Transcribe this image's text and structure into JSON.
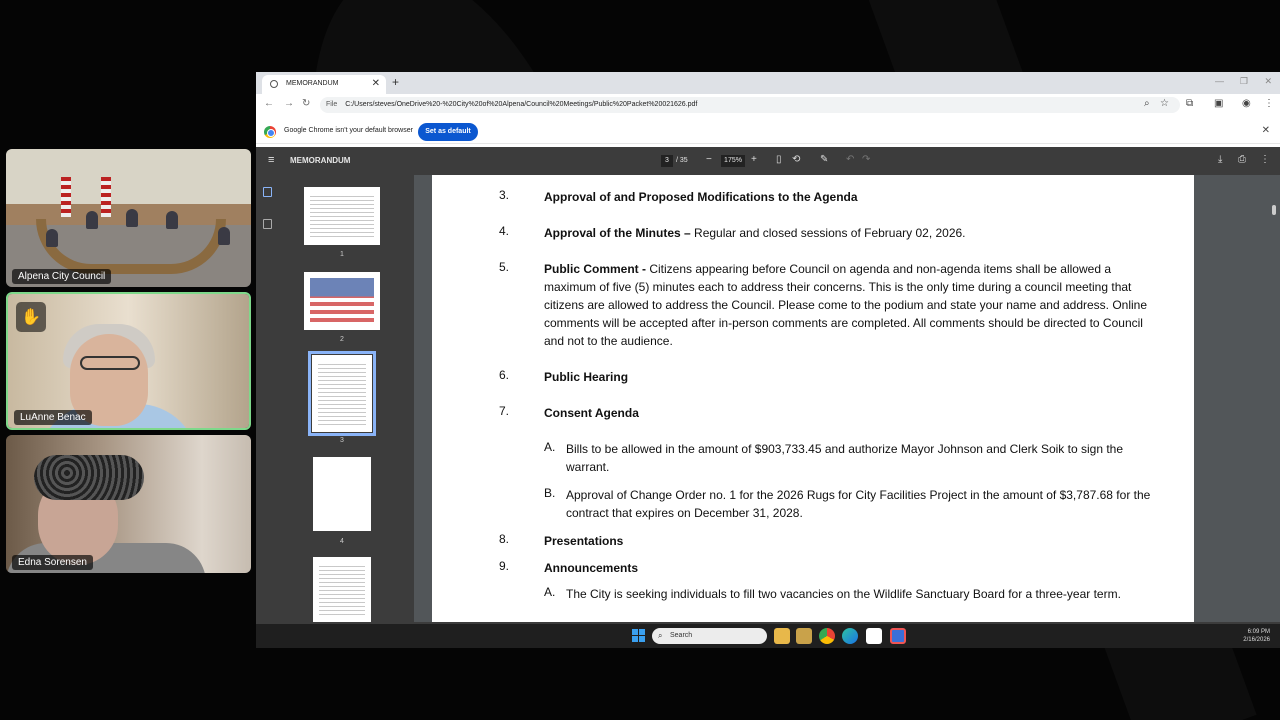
{
  "participants": [
    {
      "name": "Alpena City Council"
    },
    {
      "name": "LuAnne Benac",
      "hand_raised": true
    },
    {
      "name": "Edna Sorensen"
    }
  ],
  "browser": {
    "tab_title": "MEMORANDUM",
    "address_prefix": "File",
    "url": "C:/Users/steves/OneDrive%20-%20City%20of%20Alpena/Council%20Meetings/Public%20Packet%20021626.pdf",
    "infobar_text": "Google Chrome isn't your default browser",
    "set_default_label": "Set as default"
  },
  "pdf": {
    "title": "MEMORANDUM",
    "current_page": "3",
    "total_pages": "/ 35",
    "zoom": "175%",
    "thumbnails": [
      "1",
      "2",
      "3",
      "4"
    ],
    "selected_thumbnail": "3"
  },
  "agenda": [
    {
      "num": "3.",
      "title": "Approval of and Proposed Modifications to the Agenda",
      "text": ""
    },
    {
      "num": "4.",
      "title": "Approval of the Minutes –",
      "text": " Regular and closed sessions of February 02, 2026."
    },
    {
      "num": "5.",
      "title": "Public Comment -",
      "text": " Citizens appearing before Council on agenda and non-agenda items shall be allowed a maximum of five (5) minutes each to address their concerns. This is the only time during a council meeting that citizens are allowed to address the Council.  Please come to the podium and state your name and address.  Online comments will be accepted after in-person comments are completed.  All comments should be directed to Council and not to the audience."
    },
    {
      "num": "6.",
      "title": "Public Hearing",
      "text": ""
    },
    {
      "num": "7.",
      "title": "Consent Agenda",
      "text": ""
    },
    {
      "num": "8.",
      "title": "Presentations",
      "text": ""
    },
    {
      "num": "9.",
      "title": "Announcements",
      "text": ""
    }
  ],
  "consent_items": [
    {
      "letter": "A.",
      "text": "Bills to be allowed in the amount of $903,733.45 and authorize Mayor Johnson and Clerk Soik to sign the warrant."
    },
    {
      "letter": "B.",
      "text": "Approval of Change Order no. 1 for the 2026 Rugs for City Facilities Project in the amount of $3,787.68 for the contract that expires on December 31, 2028."
    }
  ],
  "announcement_items": [
    {
      "letter": "A.",
      "text": "The City is seeking individuals to fill two vacancies on the Wildlife Sanctuary Board for a three-year term."
    }
  ],
  "taskbar": {
    "search_placeholder": "Search",
    "time": "6:09 PM",
    "date": "2/16/2026"
  },
  "colors": {
    "accent": "#0b57d0",
    "active_speaker_border": "#7ed88a",
    "pdf_toolbar": "#3c3c3c",
    "pdf_background": "#525659"
  }
}
